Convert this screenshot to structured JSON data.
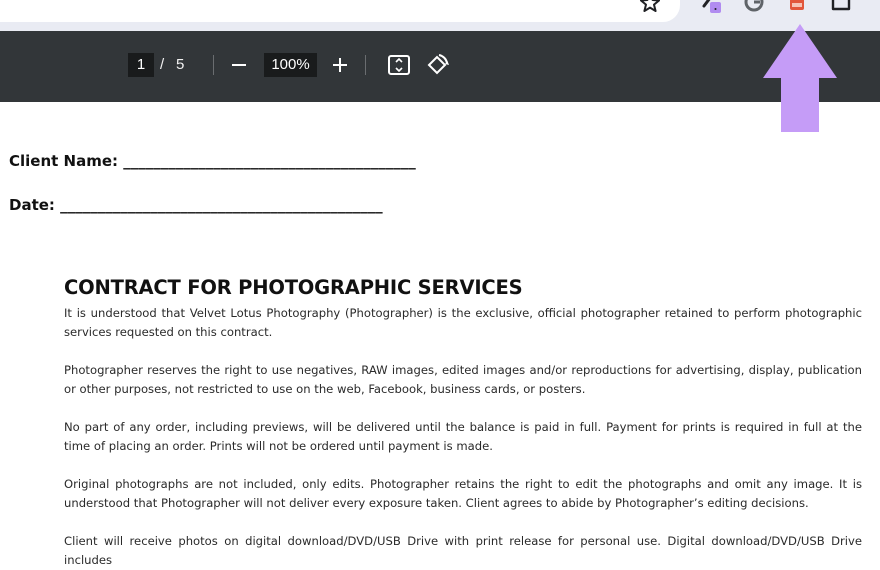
{
  "browser": {
    "star_icon": "star-outline",
    "extensions": [
      "extension-pin-icon",
      "grammarly-icon",
      "pdf-extension-icon",
      "puzzle-extensions-icon"
    ]
  },
  "pdf_toolbar": {
    "current_page": "1",
    "separator": "/",
    "total_pages": "5",
    "zoom": "100%"
  },
  "document": {
    "client_name_line": "Client Name: _______________________________________",
    "date_line": "Date: ___________________________________________",
    "title": "CONTRACT FOR PHOTOGRAPHIC SERVICES",
    "paragraphs": [
      "It is understood that Velvet Lotus Photography (Photographer) is the exclusive, official photographer retained to perform photographic services requested on this contract.",
      "Photographer reserves the right to use negatives, RAW images, edited images and/or reproductions for advertising, display, publication or other purposes, not restricted to use on the web, Facebook, business cards, or posters.",
      "No part of any order, including previews, will be delivered until the balance is paid in full. Payment for prints is required in full at the time of placing an order. Prints will not be ordered until payment is made.",
      "Original photographs are not included, only edits. Photographer retains the right to edit the photographs and omit any image. It is understood that Photographer will not deliver every exposure taken. Client agrees to abide by Photographer’s editing decisions.",
      "Client will receive photos on digital download/DVD/USB Drive with print release for personal use. Digital download/DVD/USB Drive includes"
    ]
  },
  "colors": {
    "toolbar_bg": "#323639",
    "arrow": "#c59cf7",
    "browser_bg": "#e9ebf3"
  }
}
